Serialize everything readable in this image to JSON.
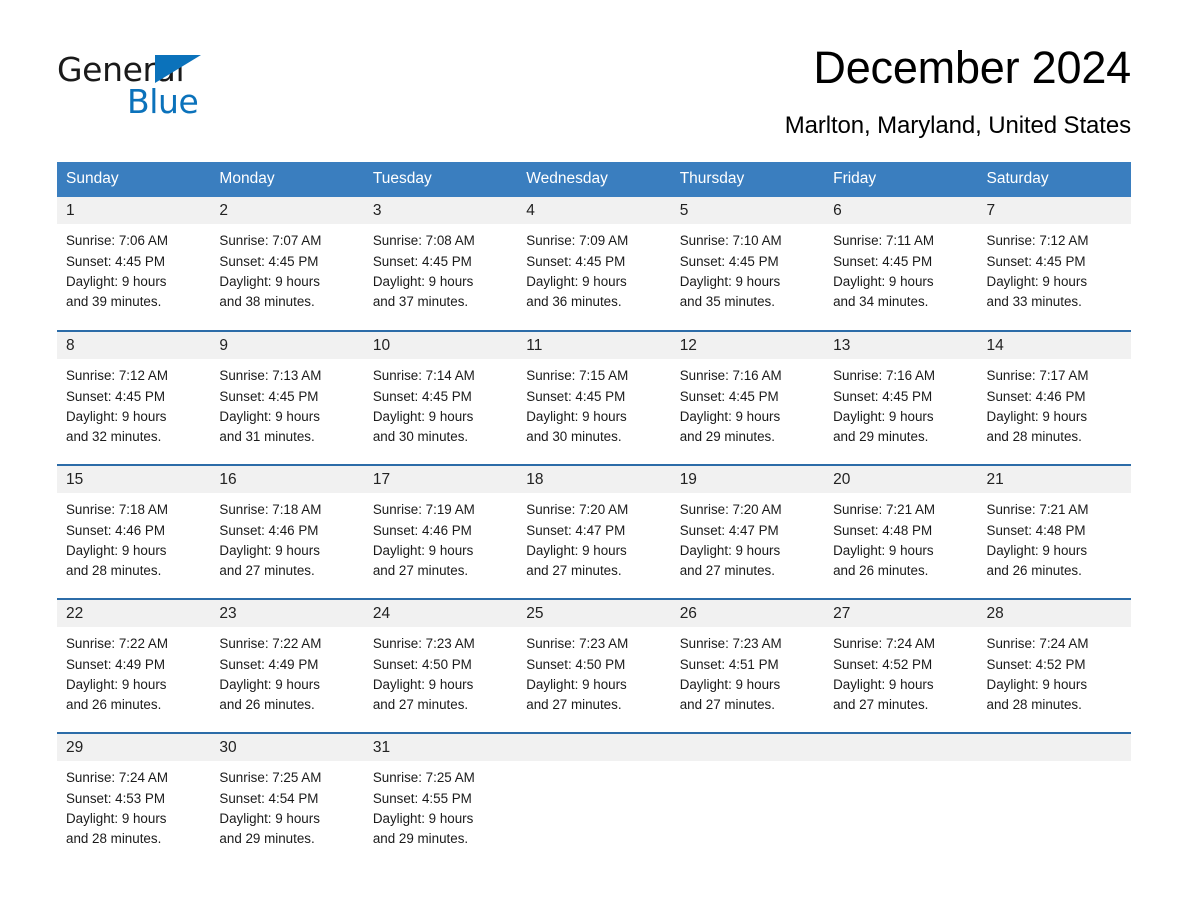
{
  "logo": {
    "word1": "General",
    "word2": "Blue",
    "triangle_color": "#0b72bb"
  },
  "header": {
    "month_title": "December 2024",
    "location": "Marlton, Maryland, United States"
  },
  "theme": {
    "header_bg": "#3a7ebf",
    "row_divider": "#2c6ca8",
    "daynum_bg": "#f1f1f1",
    "text": "#1a1a1a"
  },
  "calendar": {
    "weekdays": [
      "Sunday",
      "Monday",
      "Tuesday",
      "Wednesday",
      "Thursday",
      "Friday",
      "Saturday"
    ],
    "labels": {
      "sunrise_prefix": "Sunrise:",
      "sunset_prefix": "Sunset:",
      "daylight_prefix": "Daylight:"
    },
    "weeks": [
      [
        {
          "day": "1",
          "sunrise": "Sunrise: 7:06 AM",
          "sunset": "Sunset: 4:45 PM",
          "daylight1": "Daylight: 9 hours",
          "daylight2": "and 39 minutes."
        },
        {
          "day": "2",
          "sunrise": "Sunrise: 7:07 AM",
          "sunset": "Sunset: 4:45 PM",
          "daylight1": "Daylight: 9 hours",
          "daylight2": "and 38 minutes."
        },
        {
          "day": "3",
          "sunrise": "Sunrise: 7:08 AM",
          "sunset": "Sunset: 4:45 PM",
          "daylight1": "Daylight: 9 hours",
          "daylight2": "and 37 minutes."
        },
        {
          "day": "4",
          "sunrise": "Sunrise: 7:09 AM",
          "sunset": "Sunset: 4:45 PM",
          "daylight1": "Daylight: 9 hours",
          "daylight2": "and 36 minutes."
        },
        {
          "day": "5",
          "sunrise": "Sunrise: 7:10 AM",
          "sunset": "Sunset: 4:45 PM",
          "daylight1": "Daylight: 9 hours",
          "daylight2": "and 35 minutes."
        },
        {
          "day": "6",
          "sunrise": "Sunrise: 7:11 AM",
          "sunset": "Sunset: 4:45 PM",
          "daylight1": "Daylight: 9 hours",
          "daylight2": "and 34 minutes."
        },
        {
          "day": "7",
          "sunrise": "Sunrise: 7:12 AM",
          "sunset": "Sunset: 4:45 PM",
          "daylight1": "Daylight: 9 hours",
          "daylight2": "and 33 minutes."
        }
      ],
      [
        {
          "day": "8",
          "sunrise": "Sunrise: 7:12 AM",
          "sunset": "Sunset: 4:45 PM",
          "daylight1": "Daylight: 9 hours",
          "daylight2": "and 32 minutes."
        },
        {
          "day": "9",
          "sunrise": "Sunrise: 7:13 AM",
          "sunset": "Sunset: 4:45 PM",
          "daylight1": "Daylight: 9 hours",
          "daylight2": "and 31 minutes."
        },
        {
          "day": "10",
          "sunrise": "Sunrise: 7:14 AM",
          "sunset": "Sunset: 4:45 PM",
          "daylight1": "Daylight: 9 hours",
          "daylight2": "and 30 minutes."
        },
        {
          "day": "11",
          "sunrise": "Sunrise: 7:15 AM",
          "sunset": "Sunset: 4:45 PM",
          "daylight1": "Daylight: 9 hours",
          "daylight2": "and 30 minutes."
        },
        {
          "day": "12",
          "sunrise": "Sunrise: 7:16 AM",
          "sunset": "Sunset: 4:45 PM",
          "daylight1": "Daylight: 9 hours",
          "daylight2": "and 29 minutes."
        },
        {
          "day": "13",
          "sunrise": "Sunrise: 7:16 AM",
          "sunset": "Sunset: 4:45 PM",
          "daylight1": "Daylight: 9 hours",
          "daylight2": "and 29 minutes."
        },
        {
          "day": "14",
          "sunrise": "Sunrise: 7:17 AM",
          "sunset": "Sunset: 4:46 PM",
          "daylight1": "Daylight: 9 hours",
          "daylight2": "and 28 minutes."
        }
      ],
      [
        {
          "day": "15",
          "sunrise": "Sunrise: 7:18 AM",
          "sunset": "Sunset: 4:46 PM",
          "daylight1": "Daylight: 9 hours",
          "daylight2": "and 28 minutes."
        },
        {
          "day": "16",
          "sunrise": "Sunrise: 7:18 AM",
          "sunset": "Sunset: 4:46 PM",
          "daylight1": "Daylight: 9 hours",
          "daylight2": "and 27 minutes."
        },
        {
          "day": "17",
          "sunrise": "Sunrise: 7:19 AM",
          "sunset": "Sunset: 4:46 PM",
          "daylight1": "Daylight: 9 hours",
          "daylight2": "and 27 minutes."
        },
        {
          "day": "18",
          "sunrise": "Sunrise: 7:20 AM",
          "sunset": "Sunset: 4:47 PM",
          "daylight1": "Daylight: 9 hours",
          "daylight2": "and 27 minutes."
        },
        {
          "day": "19",
          "sunrise": "Sunrise: 7:20 AM",
          "sunset": "Sunset: 4:47 PM",
          "daylight1": "Daylight: 9 hours",
          "daylight2": "and 27 minutes."
        },
        {
          "day": "20",
          "sunrise": "Sunrise: 7:21 AM",
          "sunset": "Sunset: 4:48 PM",
          "daylight1": "Daylight: 9 hours",
          "daylight2": "and 26 minutes."
        },
        {
          "day": "21",
          "sunrise": "Sunrise: 7:21 AM",
          "sunset": "Sunset: 4:48 PM",
          "daylight1": "Daylight: 9 hours",
          "daylight2": "and 26 minutes."
        }
      ],
      [
        {
          "day": "22",
          "sunrise": "Sunrise: 7:22 AM",
          "sunset": "Sunset: 4:49 PM",
          "daylight1": "Daylight: 9 hours",
          "daylight2": "and 26 minutes."
        },
        {
          "day": "23",
          "sunrise": "Sunrise: 7:22 AM",
          "sunset": "Sunset: 4:49 PM",
          "daylight1": "Daylight: 9 hours",
          "daylight2": "and 26 minutes."
        },
        {
          "day": "24",
          "sunrise": "Sunrise: 7:23 AM",
          "sunset": "Sunset: 4:50 PM",
          "daylight1": "Daylight: 9 hours",
          "daylight2": "and 27 minutes."
        },
        {
          "day": "25",
          "sunrise": "Sunrise: 7:23 AM",
          "sunset": "Sunset: 4:50 PM",
          "daylight1": "Daylight: 9 hours",
          "daylight2": "and 27 minutes."
        },
        {
          "day": "26",
          "sunrise": "Sunrise: 7:23 AM",
          "sunset": "Sunset: 4:51 PM",
          "daylight1": "Daylight: 9 hours",
          "daylight2": "and 27 minutes."
        },
        {
          "day": "27",
          "sunrise": "Sunrise: 7:24 AM",
          "sunset": "Sunset: 4:52 PM",
          "daylight1": "Daylight: 9 hours",
          "daylight2": "and 27 minutes."
        },
        {
          "day": "28",
          "sunrise": "Sunrise: 7:24 AM",
          "sunset": "Sunset: 4:52 PM",
          "daylight1": "Daylight: 9 hours",
          "daylight2": "and 28 minutes."
        }
      ],
      [
        {
          "day": "29",
          "sunrise": "Sunrise: 7:24 AM",
          "sunset": "Sunset: 4:53 PM",
          "daylight1": "Daylight: 9 hours",
          "daylight2": "and 28 minutes."
        },
        {
          "day": "30",
          "sunrise": "Sunrise: 7:25 AM",
          "sunset": "Sunset: 4:54 PM",
          "daylight1": "Daylight: 9 hours",
          "daylight2": "and 29 minutes."
        },
        {
          "day": "31",
          "sunrise": "Sunrise: 7:25 AM",
          "sunset": "Sunset: 4:55 PM",
          "daylight1": "Daylight: 9 hours",
          "daylight2": "and 29 minutes."
        },
        {
          "day": "",
          "sunrise": "",
          "sunset": "",
          "daylight1": "",
          "daylight2": ""
        },
        {
          "day": "",
          "sunrise": "",
          "sunset": "",
          "daylight1": "",
          "daylight2": ""
        },
        {
          "day": "",
          "sunrise": "",
          "sunset": "",
          "daylight1": "",
          "daylight2": ""
        },
        {
          "day": "",
          "sunrise": "",
          "sunset": "",
          "daylight1": "",
          "daylight2": ""
        }
      ]
    ]
  }
}
